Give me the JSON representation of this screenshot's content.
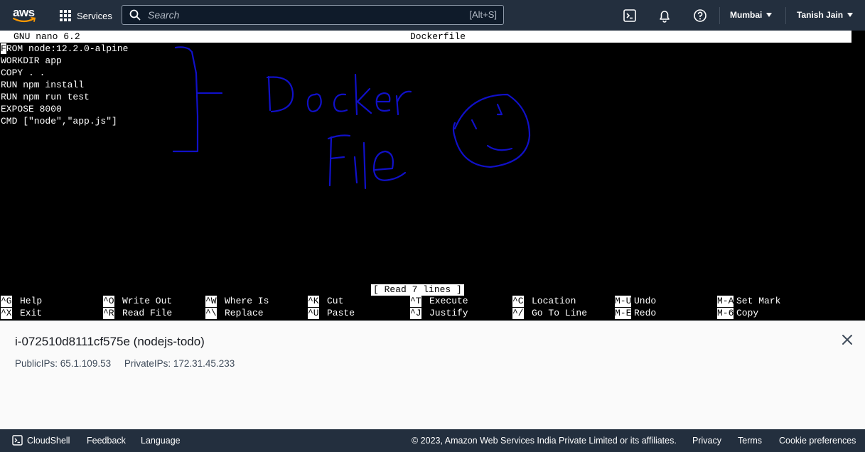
{
  "topnav": {
    "logo_text": "aws",
    "services_label": "Services",
    "search_placeholder": "Search",
    "search_shortcut": "[Alt+S]",
    "region": "Mumbai",
    "user": "Tanish Jain",
    "brand_color": "#ff9900",
    "nav_background": "#232f3e"
  },
  "terminal": {
    "nano_version": "GNU nano 6.2",
    "filename": "Dockerfile",
    "cursor_char": "F",
    "lines": [
      "ROM node:12.2.0-alpine",
      "WORKDIR app",
      "COPY . .",
      "RUN npm install",
      "RUN npm run test",
      "EXPOSE 8000",
      "CMD [\"node\",\"app.js\"]"
    ],
    "status_message": "[ Read 7 lines ]",
    "shortcuts": [
      [
        {
          "key": "^G",
          "label": "Help"
        },
        {
          "key": "^X",
          "label": "Exit"
        }
      ],
      [
        {
          "key": "^O",
          "label": "Write Out"
        },
        {
          "key": "^R",
          "label": "Read File"
        }
      ],
      [
        {
          "key": "^W",
          "label": "Where Is"
        },
        {
          "key": "^\\",
          "label": "Replace"
        }
      ],
      [
        {
          "key": "^K",
          "label": "Cut"
        },
        {
          "key": "^U",
          "label": "Paste"
        }
      ],
      [
        {
          "key": "^T",
          "label": "Execute"
        },
        {
          "key": "^J",
          "label": "Justify"
        }
      ],
      [
        {
          "key": "^C",
          "label": "Location"
        },
        {
          "key": "^/",
          "label": "Go To Line"
        }
      ],
      [
        {
          "key": "M-U",
          "label": "Undo"
        },
        {
          "key": "M-E",
          "label": "Redo"
        }
      ],
      [
        {
          "key": "M-A",
          "label": "Set Mark"
        },
        {
          "key": "M-6",
          "label": "Copy"
        }
      ]
    ],
    "annotation_color": "#1010c8"
  },
  "instance": {
    "title": "i-072510d8111cf575e (nodejs-todo)",
    "public_ips": "PublicIPs: 65.1.109.53",
    "private_ips": "PrivateIPs: 172.31.45.233"
  },
  "footer": {
    "cloudshell": "CloudShell",
    "feedback": "Feedback",
    "language": "Language",
    "copyright": "© 2023, Amazon Web Services India Private Limited or its affiliates.",
    "privacy": "Privacy",
    "terms": "Terms",
    "cookie": "Cookie preferences"
  }
}
